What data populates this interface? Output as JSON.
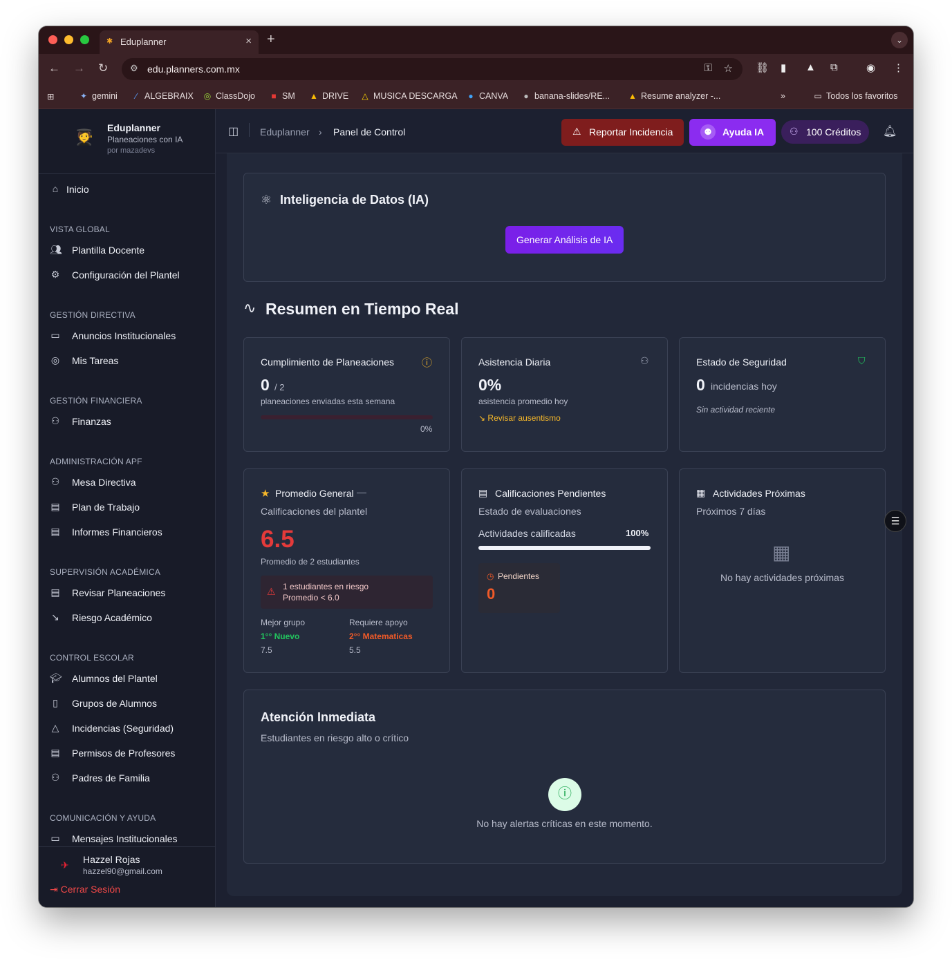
{
  "browser": {
    "tab_title": "Eduplanner",
    "url": "edu.planners.com.mx",
    "bookmarks": [
      "gemini",
      "ALGEBRAIX",
      "ClassDojo",
      "SM",
      "DRIVE",
      "MUSICA DESCARGA",
      "CANVA",
      "banana-slides/RE...",
      "Resume analyzer -...",
      "Todos los favoritos"
    ]
  },
  "sidebar": {
    "brand_name": "Eduplanner",
    "brand_sub": "Planeaciones con IA",
    "brand_by": "por mazadevs",
    "home": "Inicio",
    "sections": {
      "vista_global": "VISTA GLOBAL",
      "gestion_directiva": "GESTIÓN DIRECTIVA",
      "gestion_financiera": "GESTIÓN FINANCIERA",
      "administracion_apf": "ADMINISTRACIÓN APF",
      "supervision": "SUPERVISIÓN ACADÉMICA",
      "control_escolar": "CONTROL ESCOLAR",
      "comunicacion": "COMUNICACIÓN Y AYUDA"
    },
    "items": {
      "plantilla": "Plantilla Docente",
      "configuracion": "Configuración del Plantel",
      "anuncios": "Anuncios Institucionales",
      "tareas": "Mis Tareas",
      "finanzas": "Finanzas",
      "mesa": "Mesa Directiva",
      "plan": "Plan de Trabajo",
      "informes": "Informes Financieros",
      "revisar": "Revisar Planeaciones",
      "riesgo": "Riesgo Académico",
      "alumnos": "Alumnos del Plantel",
      "grupos": "Grupos de Alumnos",
      "incidencias": "Incidencias (Seguridad)",
      "permisos": "Permisos de Profesores",
      "padres": "Padres de Familia",
      "mensajes": "Mensajes Institucionales"
    },
    "user": {
      "name": "Hazzel Rojas",
      "email": "hazzel90@gmail.com",
      "logout": "Cerrar Sesión"
    }
  },
  "header": {
    "crumb_root": "Eduplanner",
    "crumb_current": "Panel de Control",
    "report_btn": "Reportar Incidencia",
    "ai_btn": "Ayuda IA",
    "credits": "100 Créditos"
  },
  "ia_card": {
    "title": "Inteligencia de Datos (IA)",
    "button": "Generar Análisis de IA"
  },
  "summary": {
    "title": "Resumen en Tiempo Real",
    "planeaciones": {
      "title": "Cumplimiento de Planeaciones",
      "value": "0",
      "total": "/ 2",
      "desc": "planeaciones enviadas esta semana",
      "percent_label": "0%",
      "progress": 0
    },
    "asistencia": {
      "title": "Asistencia Diaria",
      "value": "0%",
      "desc": "asistencia promedio hoy",
      "link": "Revisar ausentismo"
    },
    "seguridad": {
      "title": "Estado de Seguridad",
      "value": "0",
      "unit": "incidencias hoy",
      "note": "Sin actividad reciente"
    }
  },
  "promedio": {
    "title": "Promedio General",
    "subtitle": "Calificaciones del plantel",
    "value": "6.5",
    "desc": "Promedio de 2 estudiantes",
    "alert_title": "1 estudiantes en riesgo",
    "alert_sub": "Promedio < 6.0",
    "best_label": "Mejor grupo",
    "best_group": "1°° Nuevo",
    "best_value": "7.5",
    "support_label": "Requiere apoyo",
    "support_group": "2°° Matematicas",
    "support_value": "5.5"
  },
  "calificaciones": {
    "title": "Calificaciones Pendientes",
    "subtitle": "Estado de evaluaciones",
    "progress_label": "Actividades calificadas",
    "progress_value": "100%",
    "progress": 1.0,
    "pending_label": "Pendientes",
    "pending_value": "0"
  },
  "actividades": {
    "title": "Actividades Próximas",
    "subtitle": "Próximos 7 días",
    "empty": "No hay actividades próximas"
  },
  "atencion": {
    "title": "Atención Inmediata",
    "subtitle": "Estudiantes en riesgo alto o crítico",
    "empty": "No hay alertas críticas en este momento."
  },
  "colors": {
    "accent_purple": "#8b2cf0",
    "report_red": "#8a1c1c",
    "danger": "#e43a3a",
    "success": "#22c55e",
    "warning": "#f5b72a"
  }
}
